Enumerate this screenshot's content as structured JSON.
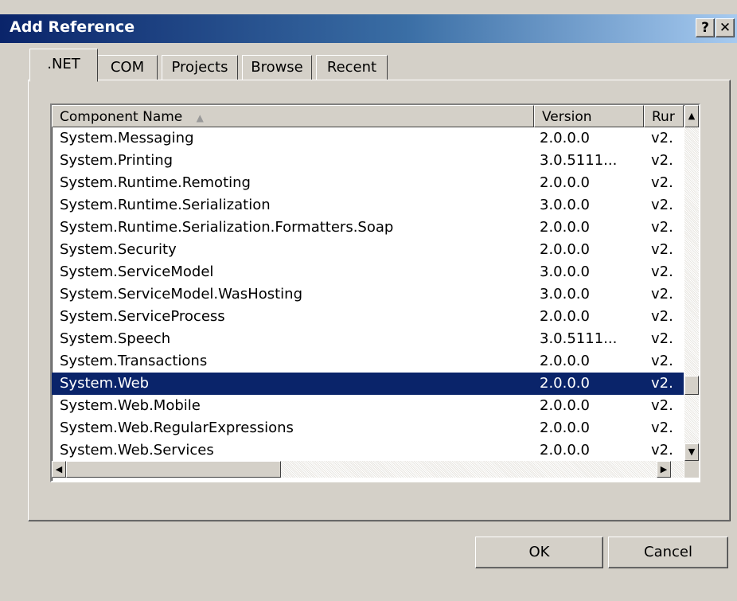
{
  "window": {
    "title": "Add Reference",
    "help_label": "?",
    "close_label": "✕"
  },
  "tabs": [
    {
      "label": ".NET",
      "active": true
    },
    {
      "label": "COM",
      "active": false
    },
    {
      "label": "Projects",
      "active": false
    },
    {
      "label": "Browse",
      "active": false
    },
    {
      "label": "Recent",
      "active": false
    }
  ],
  "list": {
    "columns": {
      "name": "Component Name",
      "sort_indicator": "▲",
      "version": "Version",
      "runtime": "Rur"
    },
    "rows": [
      {
        "name": "System.Messaging",
        "version": "2.0.0.0",
        "runtime": "v2."
      },
      {
        "name": "System.Printing",
        "version": "3.0.5111...",
        "runtime": "v2."
      },
      {
        "name": "System.Runtime.Remoting",
        "version": "2.0.0.0",
        "runtime": "v2."
      },
      {
        "name": "System.Runtime.Serialization",
        "version": "3.0.0.0",
        "runtime": "v2."
      },
      {
        "name": "System.Runtime.Serialization.Formatters.Soap",
        "version": "2.0.0.0",
        "runtime": "v2."
      },
      {
        "name": "System.Security",
        "version": "2.0.0.0",
        "runtime": "v2."
      },
      {
        "name": "System.ServiceModel",
        "version": "3.0.0.0",
        "runtime": "v2."
      },
      {
        "name": "System.ServiceModel.WasHosting",
        "version": "3.0.0.0",
        "runtime": "v2."
      },
      {
        "name": "System.ServiceProcess",
        "version": "2.0.0.0",
        "runtime": "v2."
      },
      {
        "name": "System.Speech",
        "version": "3.0.5111...",
        "runtime": "v2."
      },
      {
        "name": "System.Transactions",
        "version": "2.0.0.0",
        "runtime": "v2."
      },
      {
        "name": "System.Web",
        "version": "2.0.0.0",
        "runtime": "v2.",
        "selected": true
      },
      {
        "name": "System.Web.Mobile",
        "version": "2.0.0.0",
        "runtime": "v2."
      },
      {
        "name": "System.Web.RegularExpressions",
        "version": "2.0.0.0",
        "runtime": "v2."
      },
      {
        "name": "System.Web.Services",
        "version": "2.0.0.0",
        "runtime": "v2."
      }
    ],
    "scroll": {
      "up": "▲",
      "down": "▼",
      "left": "◀",
      "right": "▶"
    }
  },
  "buttons": {
    "ok": "OK",
    "cancel": "Cancel"
  }
}
